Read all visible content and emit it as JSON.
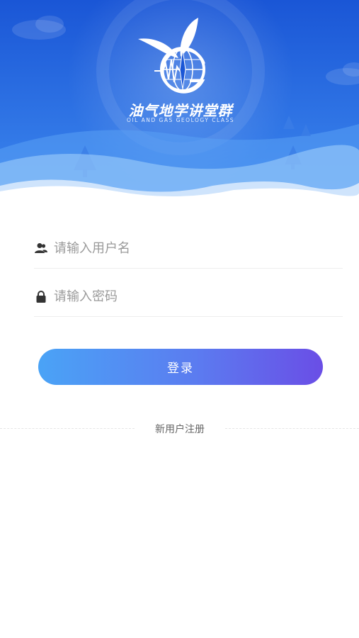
{
  "brand": {
    "title": "油气地学讲堂群",
    "subtitle": "OIL AND GAS GEOLOGY CLASS"
  },
  "form": {
    "username_placeholder": "请输入用户名",
    "password_placeholder": "请输入密码",
    "login_label": "登录"
  },
  "footer": {
    "register_label": "新用户注册"
  },
  "colors": {
    "header_blue": "#1d63e0",
    "button_start": "#4aa3f6",
    "button_end": "#6a4ee6"
  },
  "icons": {
    "username": "user-icon",
    "password": "lock-icon"
  }
}
